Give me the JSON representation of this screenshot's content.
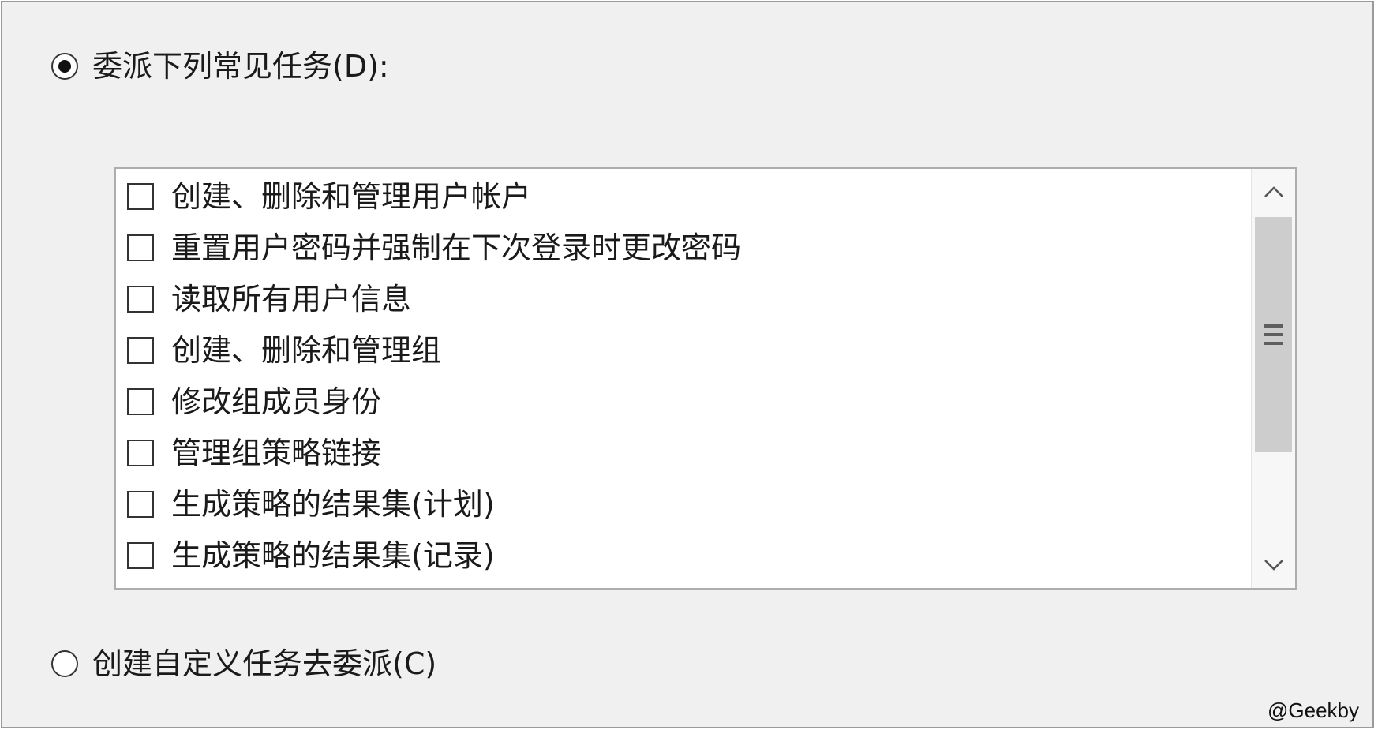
{
  "options": {
    "delegate_common": {
      "label": "委派下列常见任务(D):",
      "selected": true
    },
    "custom": {
      "label": "创建自定义任务去委派(C)",
      "selected": false
    }
  },
  "task_list": {
    "items": [
      {
        "label": "创建、删除和管理用户帐户",
        "checked": false
      },
      {
        "label": "重置用户密码并强制在下次登录时更改密码",
        "checked": false
      },
      {
        "label": "读取所有用户信息",
        "checked": false
      },
      {
        "label": "创建、删除和管理组",
        "checked": false
      },
      {
        "label": "修改组成员身份",
        "checked": false
      },
      {
        "label": "管理组策略链接",
        "checked": false
      },
      {
        "label": "生成策略的结果集(计划)",
        "checked": false
      },
      {
        "label": "生成策略的结果集(记录)",
        "checked": false
      }
    ],
    "scroll_up_icon": "chevron-up-icon",
    "scroll_down_icon": "chevron-down-icon",
    "scroll_thumb_icon": "grip-icon"
  },
  "watermark": "@Geekby"
}
